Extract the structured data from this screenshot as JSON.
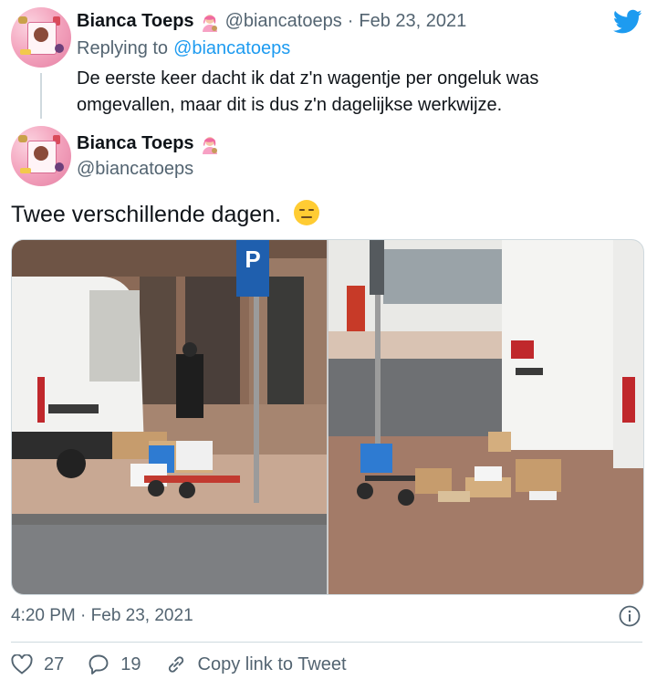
{
  "reply_tweet": {
    "display_name": "Bianca Toeps",
    "handle": "@biancatoeps",
    "date": "Feb 23, 2021",
    "replying_prefix": "Replying to",
    "replying_handle": "@biancatoeps",
    "text": "De eerste keer dacht ik dat z'n wagentje per ongeluk was omgevallen, maar dit is dus z'n dagelijkse werkwijze."
  },
  "main_tweet": {
    "display_name": "Bianca Toeps",
    "handle": "@biancatoeps",
    "text": "Twee verschillende dagen.",
    "time": "4:20 PM",
    "date": "Feb 23, 2021",
    "likes": "27",
    "replies": "19",
    "copy_link_label": "Copy link to Tweet",
    "parking_sign_letter": "P"
  },
  "colors": {
    "twitter_blue": "#1d9bf0",
    "text": "#0f1419",
    "muted": "#536471",
    "border": "#cfd9de"
  },
  "icons": [
    "twitter-bird-icon",
    "woman-artist-emoji-icon",
    "expressionless-face-emoji-icon",
    "info-icon",
    "heart-icon",
    "reply-icon",
    "link-icon"
  ]
}
